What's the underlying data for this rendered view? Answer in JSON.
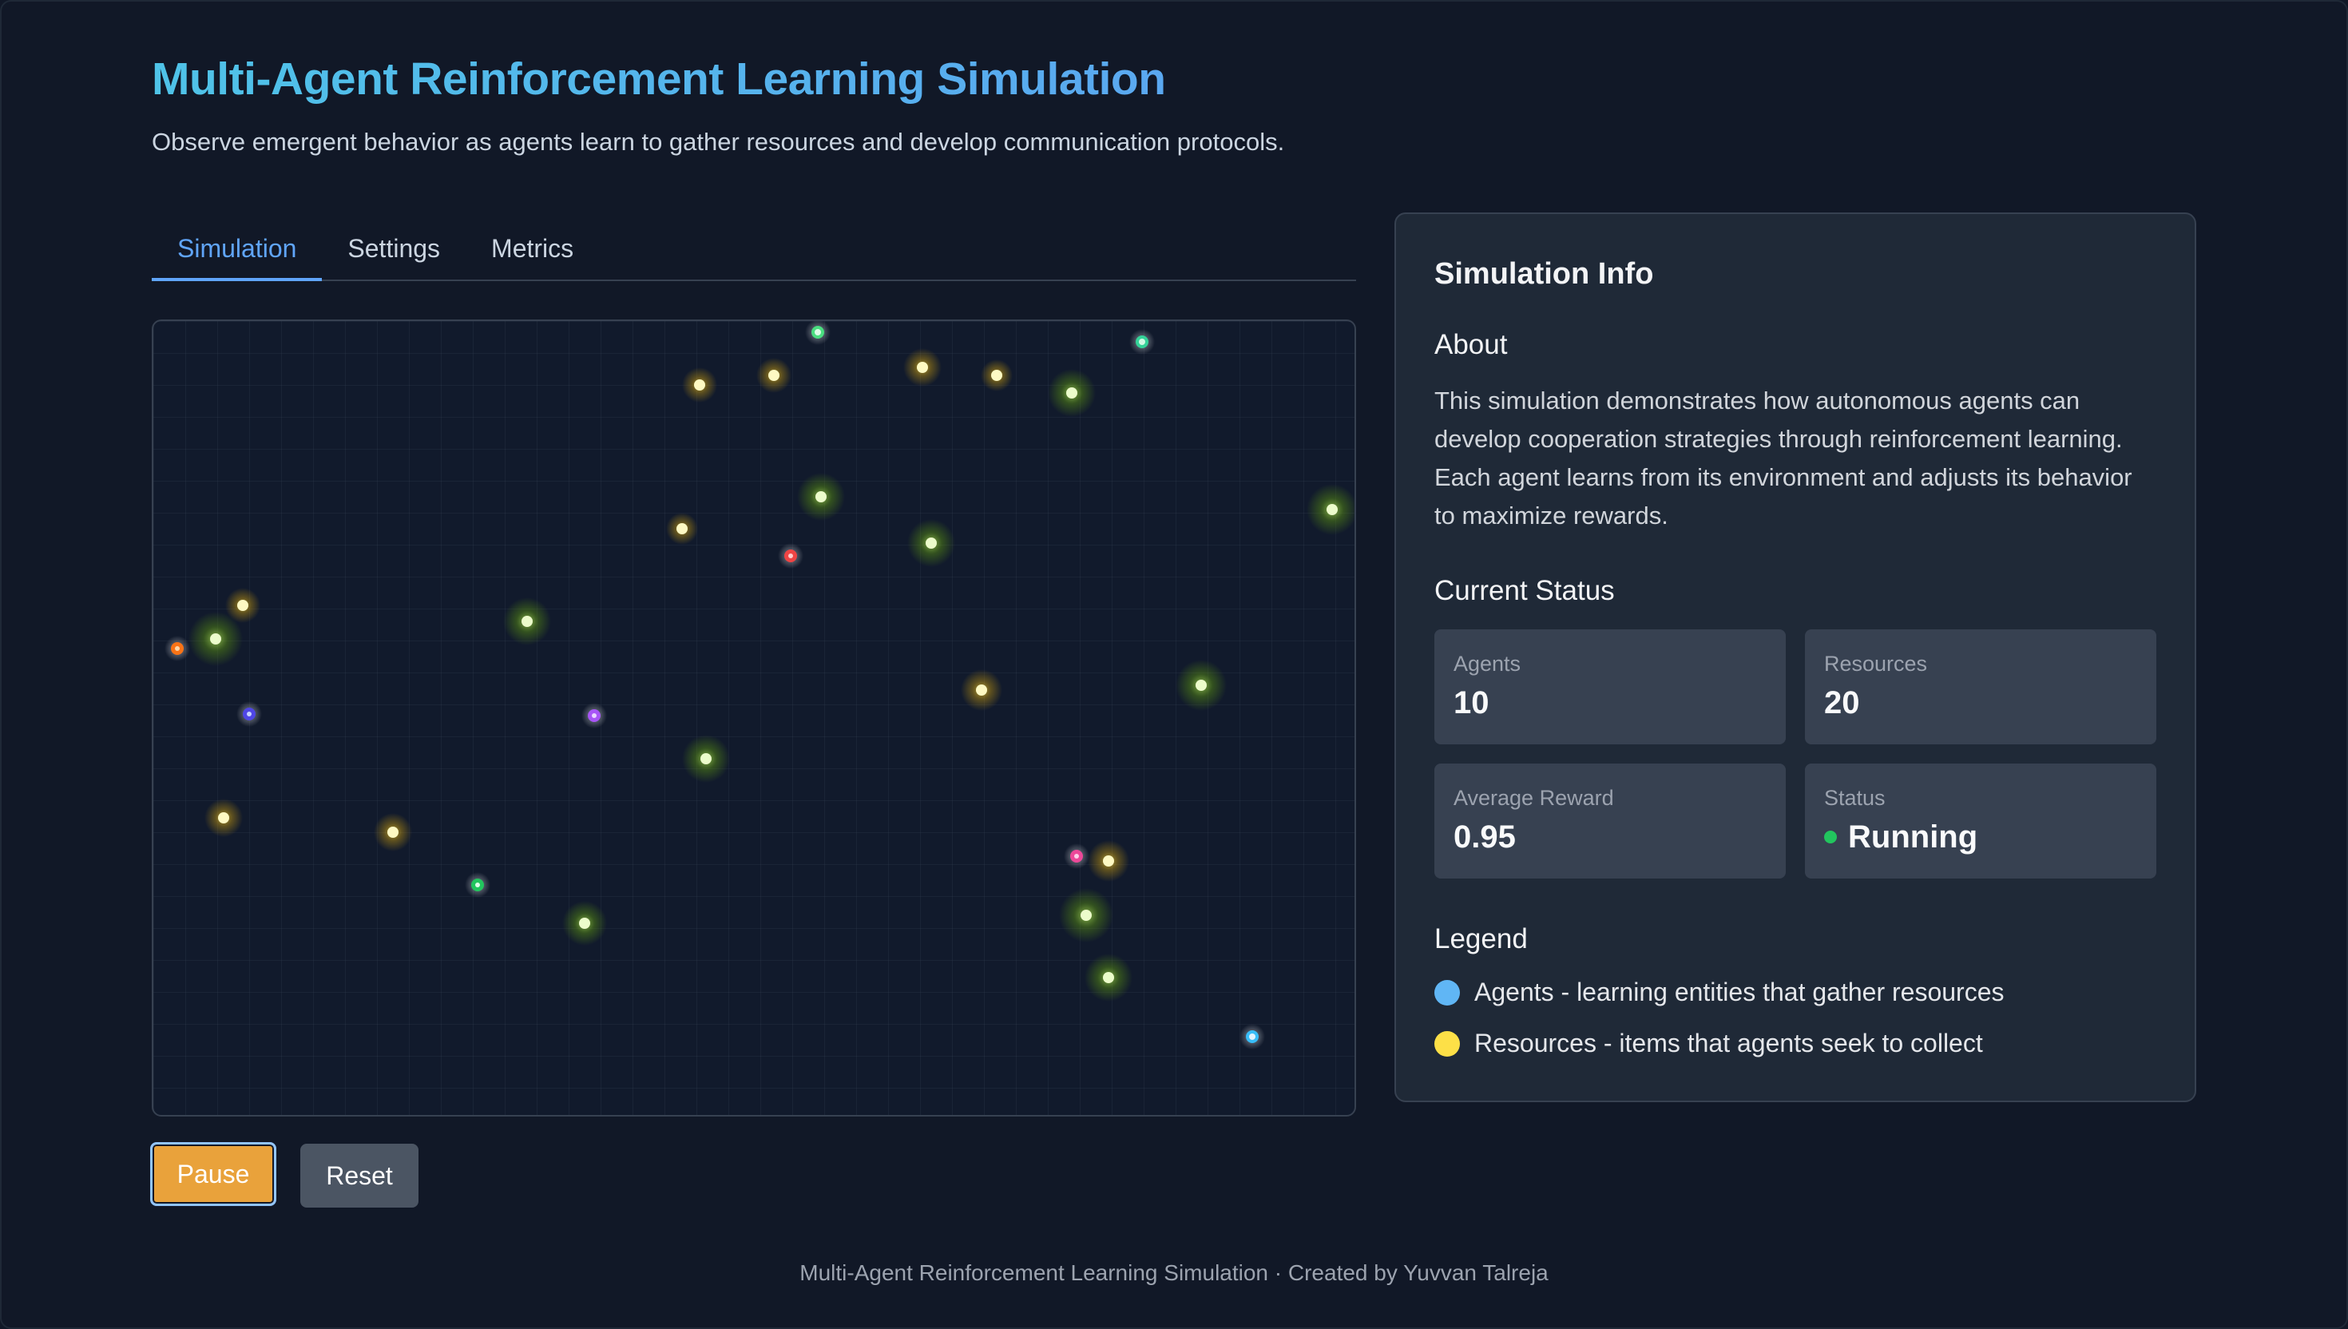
{
  "header": {
    "title": "Multi-Agent Reinforcement Learning Simulation",
    "subtitle": "Observe emergent behavior as agents learn to gather resources and develop communication protocols."
  },
  "tabs": [
    {
      "label": "Simulation",
      "active": true
    },
    {
      "label": "Settings",
      "active": false
    },
    {
      "label": "Metrics",
      "active": false
    }
  ],
  "controls": {
    "pause_label": "Pause",
    "reset_label": "Reset"
  },
  "panel": {
    "title": "Simulation Info",
    "about_heading": "About",
    "about_text": "This simulation demonstrates how autonomous agents can develop cooperation strategies through reinforcement learning. Each agent learns from its environment and adjusts its behavior to maximize rewards.",
    "status_heading": "Current Status",
    "stats": [
      {
        "label": "Agents",
        "value": "10"
      },
      {
        "label": "Resources",
        "value": "20"
      },
      {
        "label": "Average Reward",
        "value": "0.95"
      },
      {
        "label": "Status",
        "value": "Running"
      }
    ],
    "legend_heading": "Legend",
    "legend": [
      {
        "text": "Agents - learning entities that gather resources",
        "color": "#60b6f5"
      },
      {
        "text": "Resources - items that agents seek to collect",
        "color": "#fde047"
      }
    ]
  },
  "colors": {
    "accent": "#60a5fa",
    "pause_button": "#e9a23b",
    "reset_button": "#4b5563",
    "status_running": "#22c55e",
    "resource_yellow": "#facc15",
    "resource_green": "#a3e635"
  },
  "footer": {
    "text": "Multi-Agent Reinforcement Learning Simulation · Created by Yuvvan Talreja"
  }
}
